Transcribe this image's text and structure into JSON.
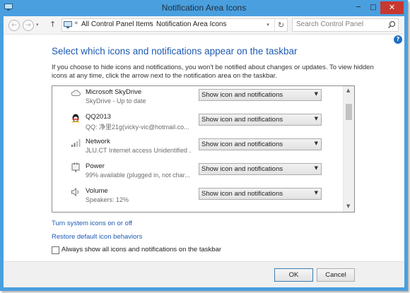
{
  "window": {
    "title": "Notification Area Icons",
    "min_glyph": "─",
    "max_glyph": "□",
    "close_glyph": "✕"
  },
  "address_bar": {
    "back_glyph": "←",
    "forward_glyph": "→",
    "recent_glyph": "▾",
    "up_glyph": "↑",
    "overflow_glyph": "«",
    "crumbs": [
      "All Control Panel Items",
      "Notification Area Icons"
    ],
    "separator": "›",
    "dropdown_glyph": "▾",
    "refresh_glyph": "↻",
    "search_placeholder": "Search Control Panel"
  },
  "help_glyph": "?",
  "heading": "Select which icons and notifications appear on the taskbar",
  "intro_text": "If you choose to hide icons and notifications, you won't be notified about changes or updates. To view hidden icons at any time, click the arrow next to the notification area on the taskbar.",
  "icons": [
    {
      "name": "Microsoft SkyDrive",
      "description": "SkyDrive - Up to date",
      "behavior": "Show icon and notifications",
      "icon": "cloud-icon"
    },
    {
      "name": "QQ2013",
      "description": "QQ: 净里21g(vicky-vic@hotmail.co...",
      "behavior": "Show icon and notifications",
      "icon": "qq-penguin-icon"
    },
    {
      "name": "Network",
      "description": "JLU.CT Internet access  Unidentified ...",
      "behavior": "Show icon and notifications",
      "icon": "network-signal-icon"
    },
    {
      "name": "Power",
      "description": "99% available (plugged in, not char...",
      "behavior": "Show icon and notifications",
      "icon": "power-plug-icon"
    },
    {
      "name": "Volume",
      "description": "Speakers: 12%",
      "behavior": "Show icon and notifications",
      "icon": "speaker-icon"
    }
  ],
  "select_arrow_glyph": "▼",
  "scroll_up_glyph": "▲",
  "scroll_down_glyph": "▼",
  "links": {
    "system_icons": "Turn system icons on or off",
    "restore_defaults": "Restore default icon behaviors"
  },
  "always_show": {
    "label": "Always show all icons and notifications on the taskbar",
    "checked": false
  },
  "buttons": {
    "ok": "OK",
    "cancel": "Cancel"
  },
  "colors": {
    "frame": "#4a9fdf",
    "heading": "#1d5ab3",
    "link": "#1d5ab3",
    "close": "#c7382f"
  }
}
